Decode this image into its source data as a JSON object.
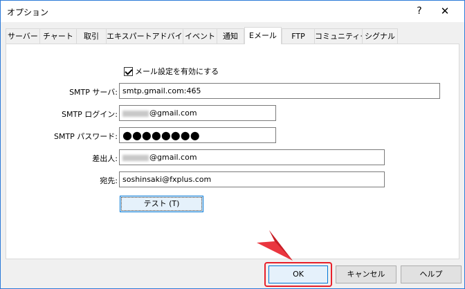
{
  "window": {
    "title": "オプション",
    "help_glyph": "?",
    "close_glyph": "✕"
  },
  "tabs": [
    {
      "label": "サーバー"
    },
    {
      "label": "チャート"
    },
    {
      "label": "取引"
    },
    {
      "label": "エキスパートアドバイザ"
    },
    {
      "label": "イベント"
    },
    {
      "label": "通知"
    },
    {
      "label": "Eメール",
      "active": true
    },
    {
      "label": "FTP"
    },
    {
      "label": "コミュニティー"
    },
    {
      "label": "シグナル"
    }
  ],
  "email": {
    "enable_label": "メール設定を有効にする",
    "enable_checked": true,
    "smtp_server_label": "SMTP サーバ:",
    "smtp_server_value": "smtp.gmail.com:465",
    "smtp_login_label": "SMTP ログイン:",
    "smtp_login_value": "@gmail.com",
    "smtp_password_label": "SMTP パスワード:",
    "smtp_password_value": "●●●●●●●●",
    "from_label": "差出人:",
    "from_value": "@gmail.com",
    "to_label": "宛先:",
    "to_value": "soshinsaki@fxplus.com",
    "test_label": "テスト (T)"
  },
  "footer": {
    "ok_label": "OK",
    "cancel_label": "キャンセル",
    "help_label": "ヘルプ"
  },
  "colors": {
    "annotation_red": "#e8202a",
    "focus_blue": "#0078d7"
  },
  "icons": [
    "checkbox-check-icon",
    "pointer-arrow-icon"
  ]
}
